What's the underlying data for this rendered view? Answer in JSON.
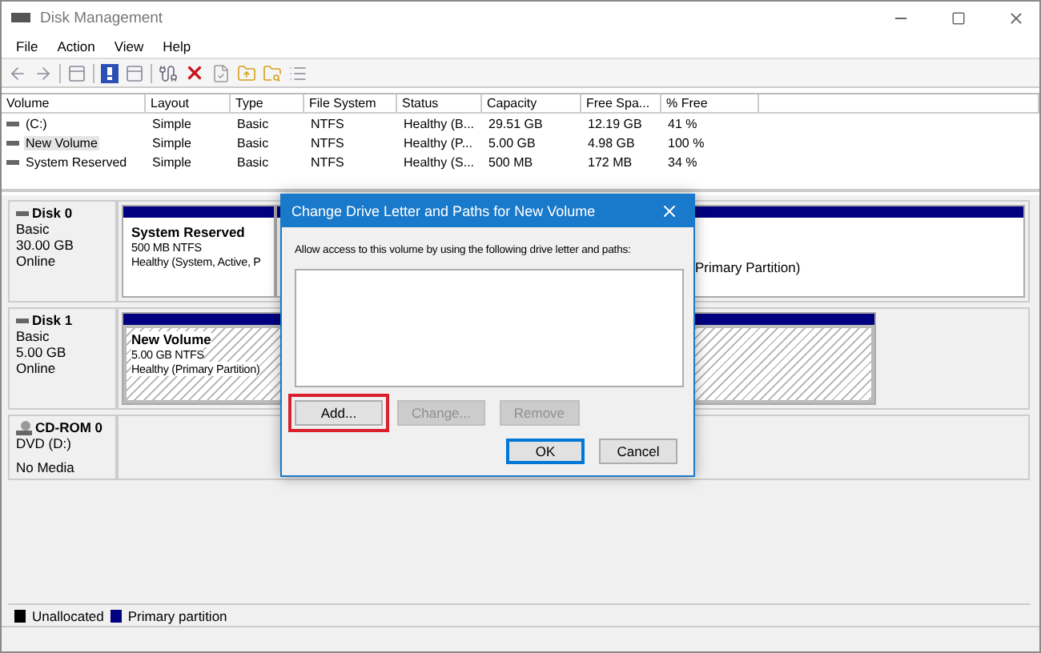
{
  "window": {
    "title": "Disk Management"
  },
  "menu": [
    "File",
    "Action",
    "View",
    "Help"
  ],
  "volumes": {
    "columns": [
      "Volume",
      "Layout",
      "Type",
      "File System",
      "Status",
      "Capacity",
      "Free Spa...",
      "% Free"
    ],
    "rows": [
      {
        "cells": [
          "(C:)",
          "Simple",
          "Basic",
          "NTFS",
          "Healthy (B...",
          "29.51 GB",
          "12.19 GB",
          "41 %"
        ],
        "selected": false
      },
      {
        "cells": [
          "New Volume",
          "Simple",
          "Basic",
          "NTFS",
          "Healthy (P...",
          "5.00 GB",
          "4.98 GB",
          "100 %"
        ],
        "selected": true
      },
      {
        "cells": [
          "System Reserved",
          "Simple",
          "Basic",
          "NTFS",
          "Healthy (S...",
          "500 MB",
          "172 MB",
          "34 %"
        ],
        "selected": false
      }
    ]
  },
  "disks": [
    {
      "kind": "disk",
      "name": "Disk 0",
      "lines": [
        "Basic",
        "30.00 GB",
        "Online"
      ],
      "partitions": [
        {
          "name": "System Reserved",
          "details": "500 MB NTFS",
          "status": "Healthy (System, Active, P",
          "selected": false
        },
        {
          "status": "Primary Partition)",
          "selected": false
        }
      ]
    },
    {
      "kind": "disk",
      "name": "Disk 1",
      "lines": [
        "Basic",
        "5.00 GB",
        "Online"
      ],
      "partitions": [
        {
          "name": "New Volume",
          "details": "5.00 GB NTFS",
          "status": "Healthy (Primary Partition)",
          "selected": true
        }
      ]
    },
    {
      "kind": "cdrom",
      "name": "CD-ROM 0",
      "lines": [
        "DVD (D:)",
        "No Media"
      ]
    }
  ],
  "legend": [
    {
      "label": "Unallocated",
      "color": "#000000"
    },
    {
      "label": "Primary partition",
      "color": "#000080"
    }
  ],
  "dialog": {
    "title": "Change Drive Letter and Paths for New Volume",
    "prompt": "Allow access to this volume by using the following drive letter and paths:",
    "actions": [
      {
        "label": "Add...",
        "disabled": false,
        "highlighted": true
      },
      {
        "label": "Change...",
        "disabled": true,
        "highlighted": false
      },
      {
        "label": "Remove",
        "disabled": true,
        "highlighted": false
      }
    ],
    "buttons": [
      {
        "label": "OK",
        "default": true
      },
      {
        "label": "Cancel",
        "default": false
      }
    ]
  }
}
